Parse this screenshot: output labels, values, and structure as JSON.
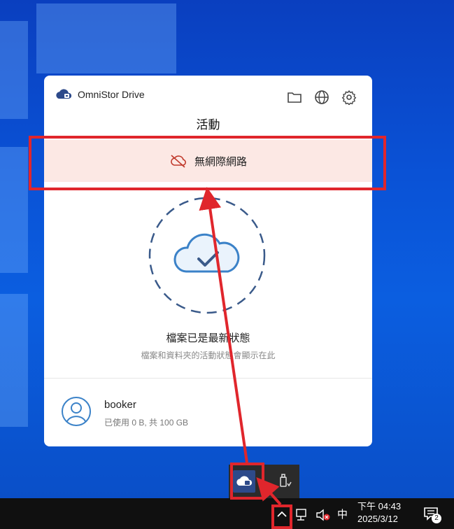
{
  "panel": {
    "app_name": "OmniStor Drive",
    "title": "活動",
    "offline_banner": "無網際網路",
    "status_title": "檔案已是最新狀態",
    "status_subtitle": "檔案和資料夾的活動狀態會顯示在此",
    "user_name": "booker",
    "storage_usage": "已使用 0 B, 共 100 GB",
    "header_icons": [
      "folder-icon",
      "globe-icon",
      "gear-icon"
    ]
  },
  "taskbar": {
    "ime": "中",
    "clock_time": "下午 04:43",
    "clock_date": "2025/3/12",
    "notification_count": "2"
  },
  "colors": {
    "accent": "#2d4a8a",
    "banner_bg": "#fce8e4",
    "annotation_red": "#e0262c",
    "cloud_blue": "#3b82c8"
  }
}
